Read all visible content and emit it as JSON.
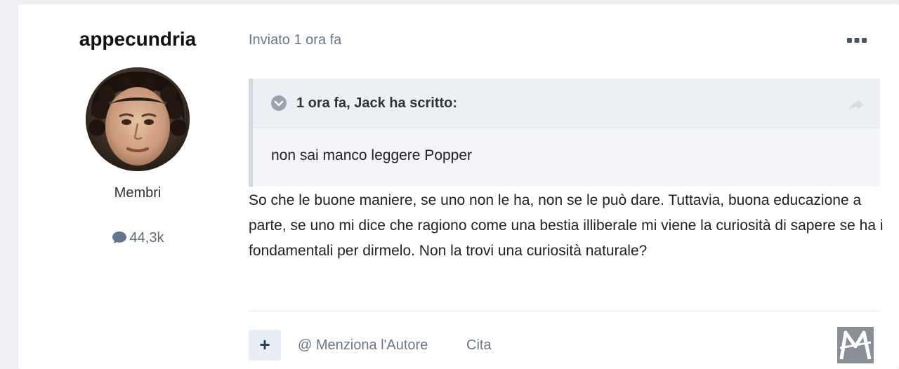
{
  "author": {
    "name": "appecundria",
    "group": "Membri",
    "post_count": "44,3k"
  },
  "post": {
    "time_label": "Inviato 1 ora fa",
    "quote": {
      "citation": "1 ora fa, Jack ha scritto:",
      "text": "non sai manco leggere Popper"
    },
    "body": "So che le buone maniere, se uno non le ha, non se le può dare. Tuttavia, buona educazione a parte, se uno mi dice che ragiono come una bestia illiberale mi viene la curiosità di sapere se ha i fondamentali per dirmelo. Non la trovi una curiosità naturale?"
  },
  "actions": {
    "plus_label": "+",
    "mention_label": "@ Menziona l'Autore",
    "quote_label": "Cita"
  },
  "icons": {
    "more": "ellipsis-icon",
    "toggle": "chevron-circle-icon",
    "share": "share-arrow-icon",
    "comment": "comment-bubble-icon"
  },
  "colors": {
    "background": "#eef0f3",
    "card": "#ffffff",
    "quote_bg": "#f3f5f8",
    "quote_border": "#d2d8df",
    "muted_text": "#6b7785",
    "plus_button_bg": "#e8eef4",
    "plus_button_fg": "#1f3d5c"
  }
}
